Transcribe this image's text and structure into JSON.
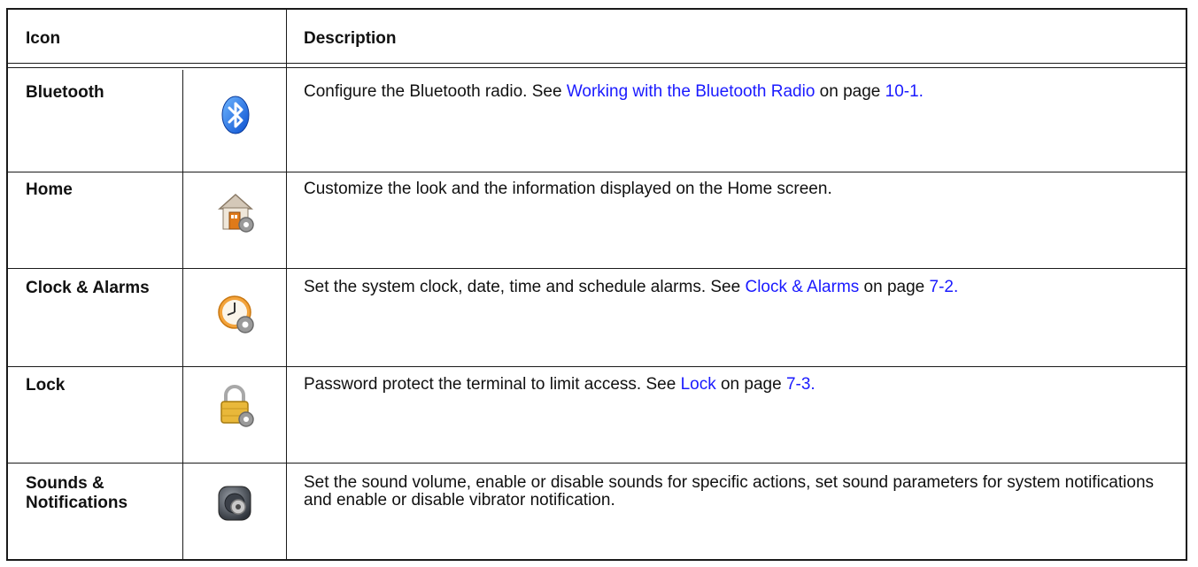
{
  "headers": {
    "icon": "Icon",
    "description": "Description"
  },
  "rows": [
    {
      "name": "Bluetooth",
      "icon": "bluetooth-icon",
      "desc_pre": "Configure the Bluetooth radio. See ",
      "link1": "Working with the Bluetooth Radio",
      "desc_mid": " on page ",
      "link2": "10-1.",
      "desc_post": ""
    },
    {
      "name": "Home",
      "icon": "home-settings-icon",
      "desc_pre": "Customize the look and the information displayed on the Home screen.",
      "link1": "",
      "desc_mid": "",
      "link2": "",
      "desc_post": ""
    },
    {
      "name": "Clock & Alarms",
      "icon": "clock-settings-icon",
      "desc_pre": "Set the system clock, date, time and schedule alarms. See ",
      "link1": "Clock & Alarms",
      "desc_mid": " on page ",
      "link2": "7-2.",
      "desc_post": ""
    },
    {
      "name": "Lock",
      "icon": "lock-settings-icon",
      "desc_pre": "Password protect the terminal to limit access. See ",
      "link1": "Lock",
      "desc_mid": " on page ",
      "link2": "7-3.",
      "desc_post": ""
    },
    {
      "name": "Sounds & Notifications",
      "icon": "speaker-settings-icon",
      "desc_pre": "Set the sound volume, enable or disable sounds for specific actions, set sound parameters for system notifications and enable or disable vibrator notification.",
      "link1": "",
      "desc_mid": "",
      "link2": "",
      "desc_post": ""
    }
  ],
  "colors": {
    "link": "#1a1aff",
    "border": "#1a1a1a"
  }
}
